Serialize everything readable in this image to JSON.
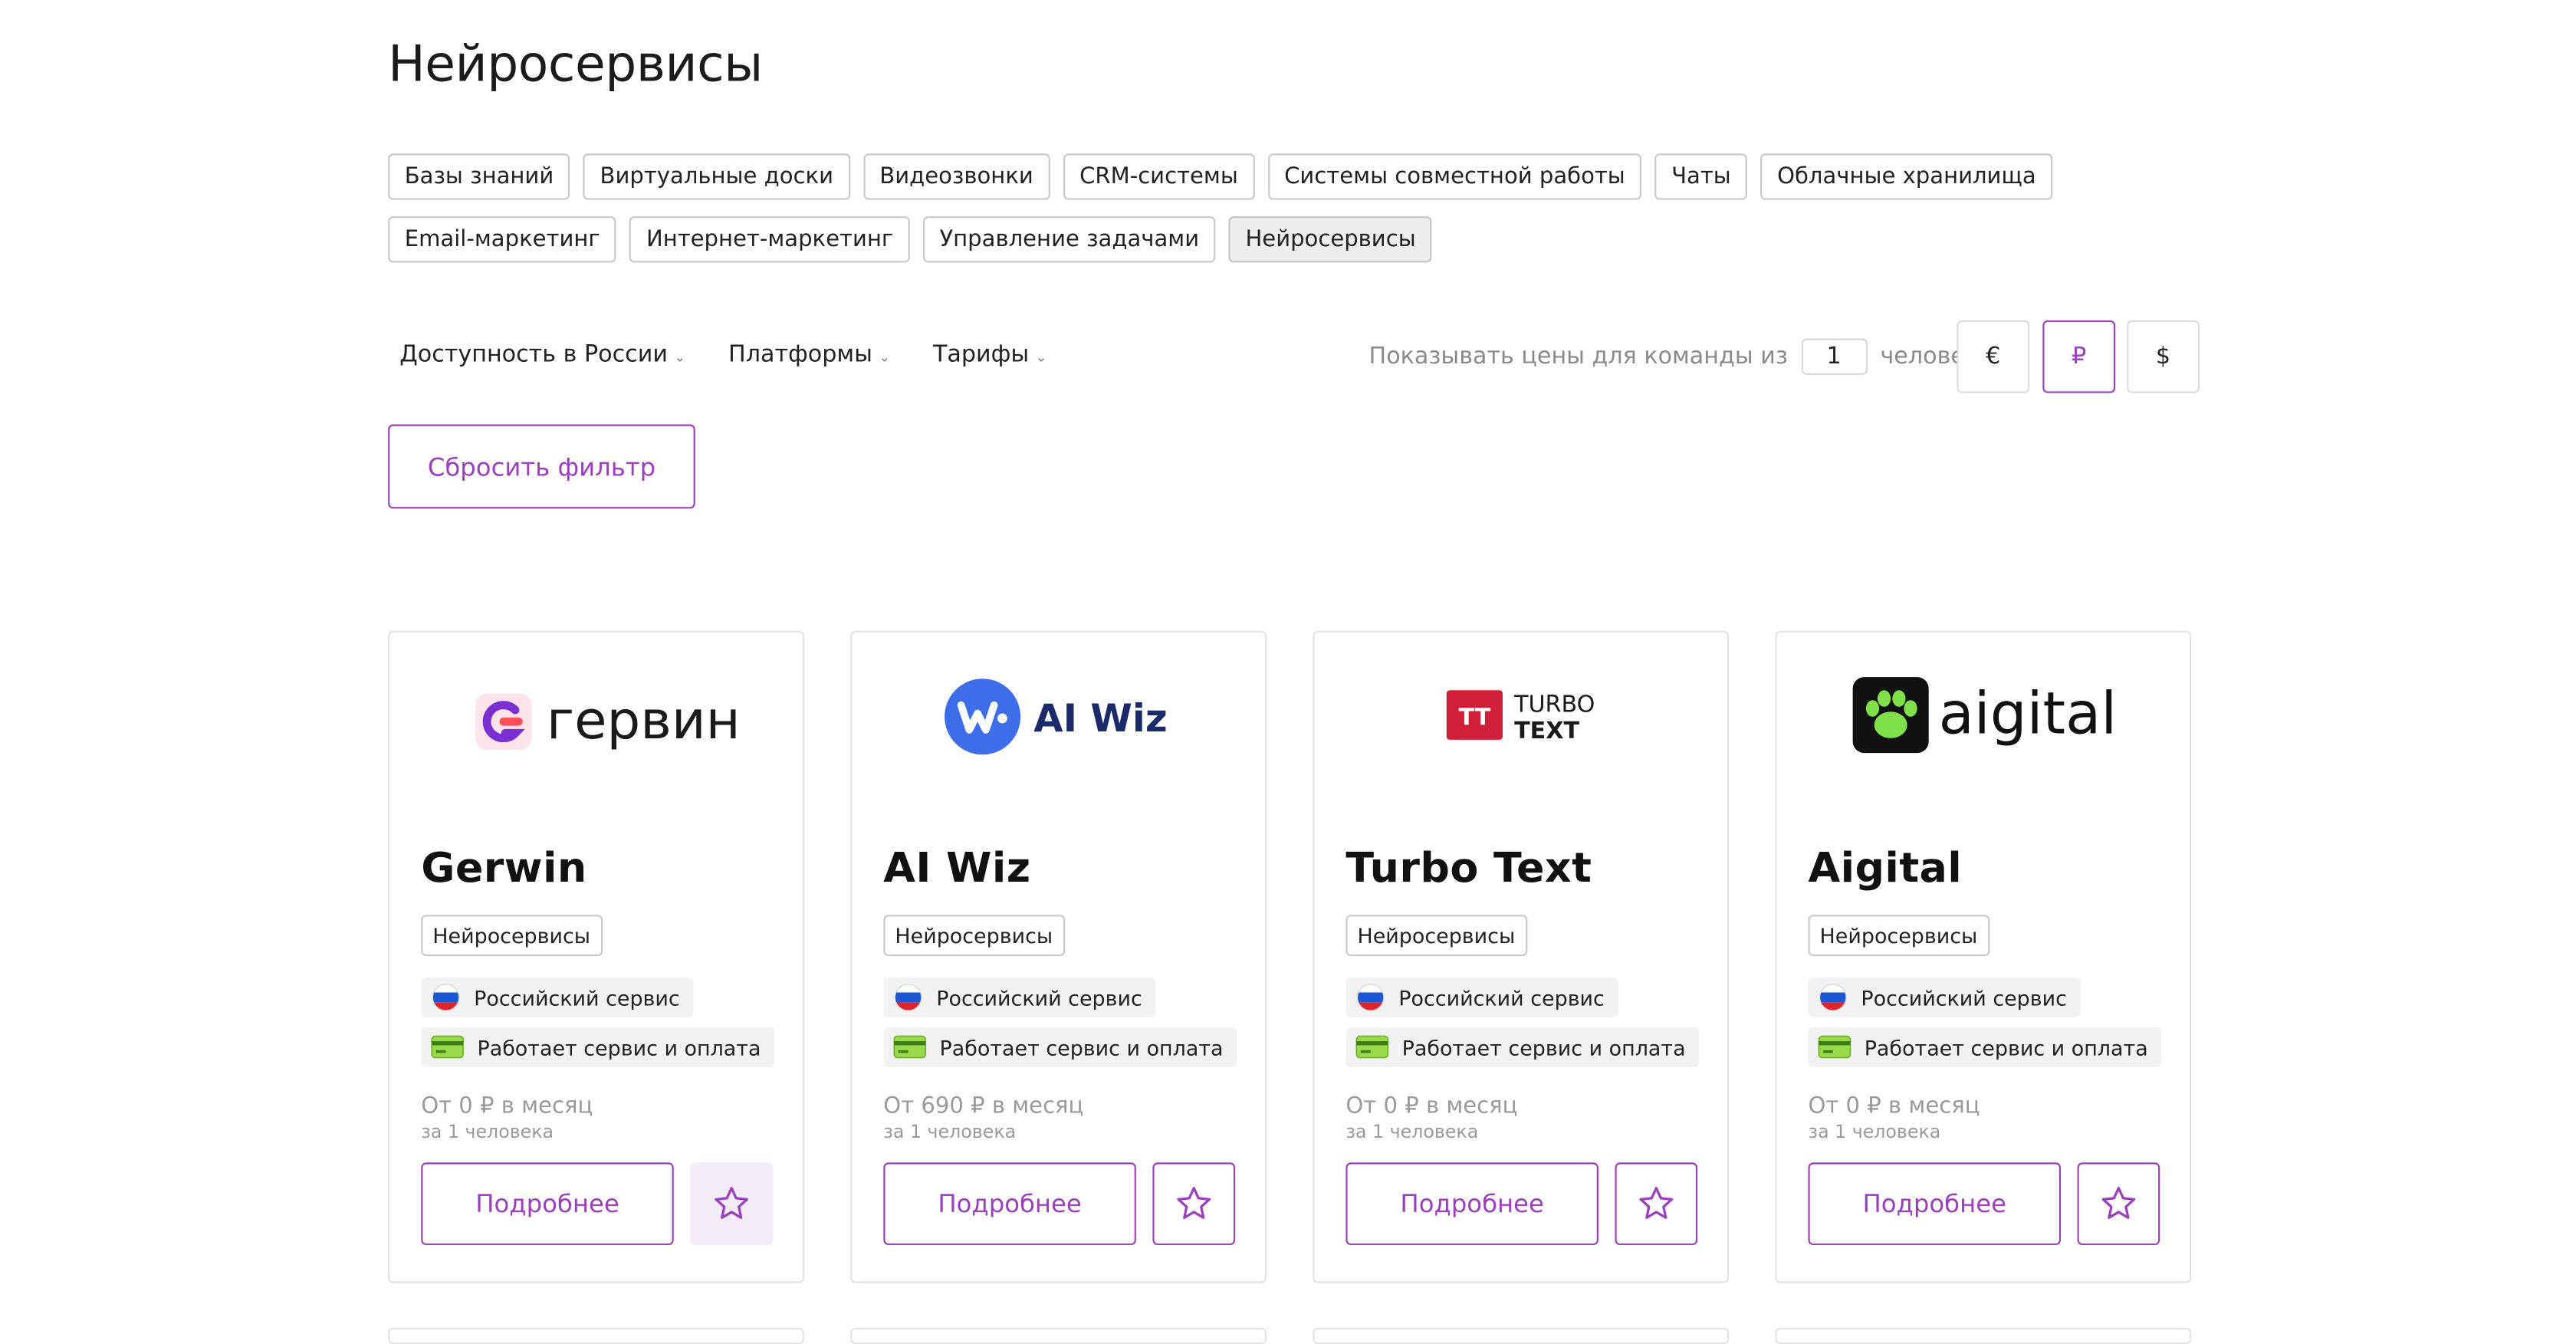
{
  "page": {
    "title": "Нейросервисы"
  },
  "categories": [
    "Базы знаний",
    "Виртуальные доски",
    "Видеозвонки",
    "CRM-системы",
    "Системы совместной работы",
    "Чаты",
    "Облачные хранилища",
    "Email-маркетинг",
    "Интернет-маркетинг",
    "Управление задачами",
    "Нейросервисы"
  ],
  "active_category": "Нейросервисы",
  "filters": {
    "availability": "Доступность в России",
    "platforms": "Платформы",
    "tariffs": "Тарифы"
  },
  "team": {
    "prefix": "Показывать цены для команды из",
    "value": "1",
    "suffix": "человека"
  },
  "currency": {
    "options": [
      "€",
      "₽",
      "$"
    ],
    "selected": "₽"
  },
  "reset_label": "Сбросить фильтр",
  "cards": [
    {
      "logo_text": "гервин",
      "name": "Gerwin",
      "category": "Нейросервисы",
      "feature_ru": "Российский сервис",
      "feature_pay": "Работает сервис и оплата",
      "price": "От 0  ₽  в месяц",
      "price_note": "за 1 человека",
      "more": "Подробнее"
    },
    {
      "logo_text": "AI Wiz",
      "name": "AI Wiz",
      "category": "Нейросервисы",
      "feature_ru": "Российский сервис",
      "feature_pay": "Работает сервис и оплата",
      "price": "От 690  ₽  в месяц",
      "price_note": "за 1 человека",
      "more": "Подробнее"
    },
    {
      "logo_text": "TURBO TEXT",
      "logo_line1": "TURBO",
      "logo_line2": "TEXT",
      "logo_mark": "TT",
      "name": "Turbo Text",
      "category": "Нейросервисы",
      "feature_ru": "Российский сервис",
      "feature_pay": "Работает сервис и оплата",
      "price": "От 0  ₽  в месяц",
      "price_note": "за 1 человека",
      "more": "Подробнее"
    },
    {
      "logo_text": "aigital",
      "name": "Aigital",
      "category": "Нейросервисы",
      "feature_ru": "Российский сервис",
      "feature_pay": "Работает сервис и оплата",
      "price": "От 0  ₽  в месяц",
      "price_note": "за 1 человека",
      "more": "Подробнее"
    }
  ],
  "colors": {
    "accent": "#9b3fbf",
    "muted": "#9a9a9a",
    "chip_border": "#c9c9c9"
  }
}
